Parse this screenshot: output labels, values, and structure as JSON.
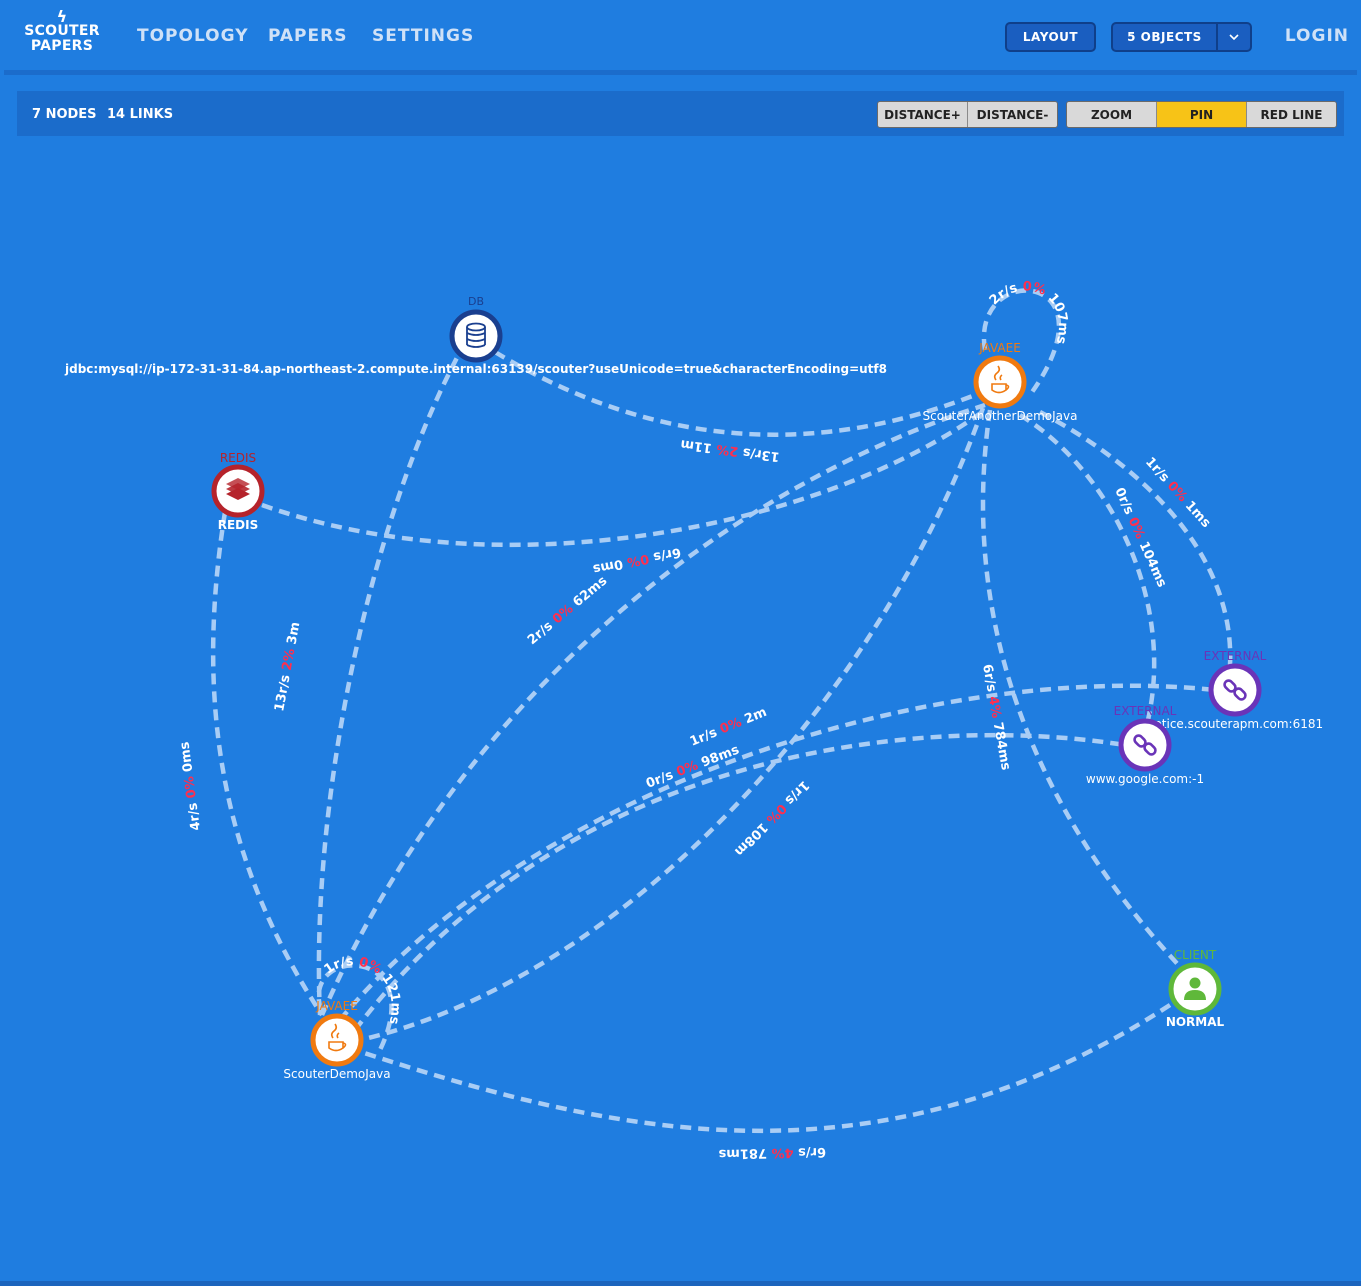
{
  "header": {
    "logo_line1": "SCOUTER",
    "logo_line2": "PAPERS",
    "nav": [
      "TOPOLOGY",
      "PAPERS",
      "SETTINGS"
    ],
    "layout_label": "LAYOUT",
    "objects_label": "5 OBJECTS",
    "login_label": "LOGIN"
  },
  "toolbar": {
    "nodes_count": "7 NODES",
    "links_count": "14 LINKS",
    "distance_plus": "DISTANCE+",
    "distance_minus": "DISTANCE-",
    "zoom": "ZOOM",
    "pin": "PIN",
    "red_line": "RED LINE",
    "active": "PIN"
  },
  "colors": {
    "background": "#1f7de0",
    "link": "#a9cdf5",
    "error": "#ff2f4f",
    "javaee": "#f07a10",
    "db": "#1a3f8f",
    "redis": "#b5232b",
    "external": "#6a34b8",
    "client": "#5fb83a"
  },
  "nodes": {
    "db": {
      "type": "DB",
      "name": "jdbc:mysql://ip-172-31-31-84.ap-northeast-2.compute.internal:63139/scouter?useUnicode=true&characterEncoding=utf8",
      "icon": "database-icon"
    },
    "redis": {
      "type": "REDIS",
      "name": "REDIS",
      "icon": "stack-icon"
    },
    "another": {
      "type": "JAVAEE",
      "name": "ScouterAnotherDemoJava",
      "icon": "java-icon"
    },
    "demo": {
      "type": "JAVAEE",
      "name": "ScouterDemoJava",
      "icon": "java-icon"
    },
    "ext1": {
      "type": "EXTERNAL",
      "name": "notice.scouterapm.com:6181",
      "icon": "link-icon"
    },
    "ext2": {
      "type": "EXTERNAL",
      "name": "www.google.com:-1",
      "icon": "link-icon"
    },
    "client": {
      "type": "CLIENT",
      "name": "NORMAL",
      "icon": "user-icon"
    }
  },
  "links": [
    {
      "id": "demo-self",
      "rate": "1r/s",
      "err": "0%",
      "time": "121ms"
    },
    {
      "id": "another-self",
      "rate": "2r/s",
      "err": "0%",
      "time": "107ms"
    },
    {
      "id": "db-another",
      "rate": "13r/s",
      "err": "2%",
      "time": "11ms"
    },
    {
      "id": "redis-another",
      "rate": "6r/s",
      "err": "0%",
      "time": "0ms"
    },
    {
      "id": "another-ext1",
      "rate": "1r/s",
      "err": "0%",
      "time": "1ms"
    },
    {
      "id": "another-ext2",
      "rate": "0r/s",
      "err": "0%",
      "time": "104ms"
    },
    {
      "id": "another-client",
      "rate": "6r/s",
      "err": "4%",
      "time": "784ms"
    },
    {
      "id": "another-demo",
      "rate": "1r/s",
      "err": "0%",
      "time": "108ms"
    },
    {
      "id": "demo-another",
      "rate": "2r/s",
      "err": "0%",
      "time": "62ms"
    },
    {
      "id": "demo-db",
      "rate": "13r/s",
      "err": "2%",
      "time": "3ms"
    },
    {
      "id": "redis-demo",
      "rate": "4r/s",
      "err": "0%",
      "time": "0ms"
    },
    {
      "id": "demo-ext1",
      "rate": "1r/s",
      "err": "0%",
      "time": "2ms"
    },
    {
      "id": "demo-ext2",
      "rate": "0r/s",
      "err": "0%",
      "time": "98ms"
    },
    {
      "id": "client-demo",
      "rate": "6r/s",
      "err": "4%",
      "time": "781ms"
    }
  ]
}
